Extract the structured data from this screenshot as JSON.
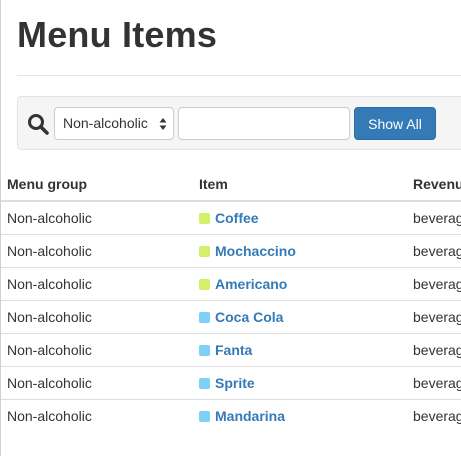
{
  "page": {
    "title": "Menu Items"
  },
  "filter": {
    "search_icon": "search-icon",
    "group_select": {
      "selected": "Non-alcoholic"
    },
    "text_input": {
      "value": "",
      "placeholder": ""
    },
    "show_all_label": "Show All",
    "accent_color": "#337ab7"
  },
  "table": {
    "headers": {
      "group": "Menu group",
      "item": "Item",
      "revenue": "Revenu"
    },
    "rows": [
      {
        "group": "Non-alcoholic",
        "item": "Coffee",
        "item_color": "#d4f06b",
        "revenue": "beverag"
      },
      {
        "group": "Non-alcoholic",
        "item": "Mochaccino",
        "item_color": "#d4f06b",
        "revenue": "beverag"
      },
      {
        "group": "Non-alcoholic",
        "item": "Americano",
        "item_color": "#d4f06b",
        "revenue": "beverag"
      },
      {
        "group": "Non-alcoholic",
        "item": "Coca Cola",
        "item_color": "#7fd0f7",
        "revenue": "beverag"
      },
      {
        "group": "Non-alcoholic",
        "item": "Fanta",
        "item_color": "#7fd0f7",
        "revenue": "beverag"
      },
      {
        "group": "Non-alcoholic",
        "item": "Sprite",
        "item_color": "#7fd0f7",
        "revenue": "beverag"
      },
      {
        "group": "Non-alcoholic",
        "item": "Mandarina",
        "item_color": "#7fd0f7",
        "revenue": "beverag"
      }
    ]
  }
}
